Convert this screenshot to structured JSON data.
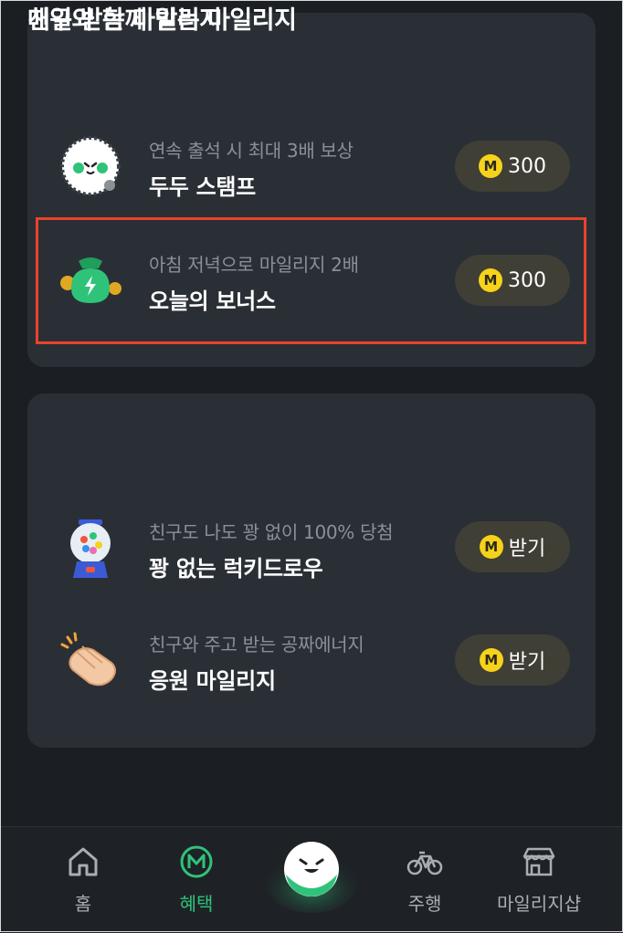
{
  "colors": {
    "background": "#1b1f23",
    "card": "#2a2f36",
    "accent_green": "#2fc37a",
    "coin_yellow": "#f6d21a",
    "highlight_red": "#e8442a"
  },
  "daily_section": {
    "title": "매일 받는 마일리지",
    "items": [
      {
        "icon": "stamp-character-icon",
        "subtitle": "연속 출석 시 최대 3배 보상",
        "title": "두두 스탬프",
        "coin_label": "M",
        "reward": "300"
      },
      {
        "icon": "money-bag-icon",
        "subtitle": "아침 저녁으로 마일리지 2배",
        "title": "오늘의 보너스",
        "coin_label": "M",
        "reward": "300"
      }
    ]
  },
  "friends_section": {
    "title": "친구와 함께 받는 마일리지",
    "items": [
      {
        "icon": "gumball-machine-icon",
        "subtitle": "친구도 나도 꽝 없이 100% 당첨",
        "title": "꽝 없는 럭키드로우",
        "coin_label": "M",
        "reward": "받기"
      },
      {
        "icon": "clapping-hands-icon",
        "subtitle": "친구와 주고 받는 공짜에너지",
        "title": "응원 마일리지",
        "coin_label": "M",
        "reward": "받기"
      }
    ]
  },
  "bottom_nav": {
    "items": [
      {
        "label": "홈",
        "icon": "home-icon"
      },
      {
        "label": "혜택",
        "icon": "mileage-icon",
        "active": true
      },
      {
        "label": "",
        "icon": "character-center-icon"
      },
      {
        "label": "주행",
        "icon": "bicycle-icon"
      },
      {
        "label": "마일리지샵",
        "icon": "shop-icon"
      }
    ]
  }
}
